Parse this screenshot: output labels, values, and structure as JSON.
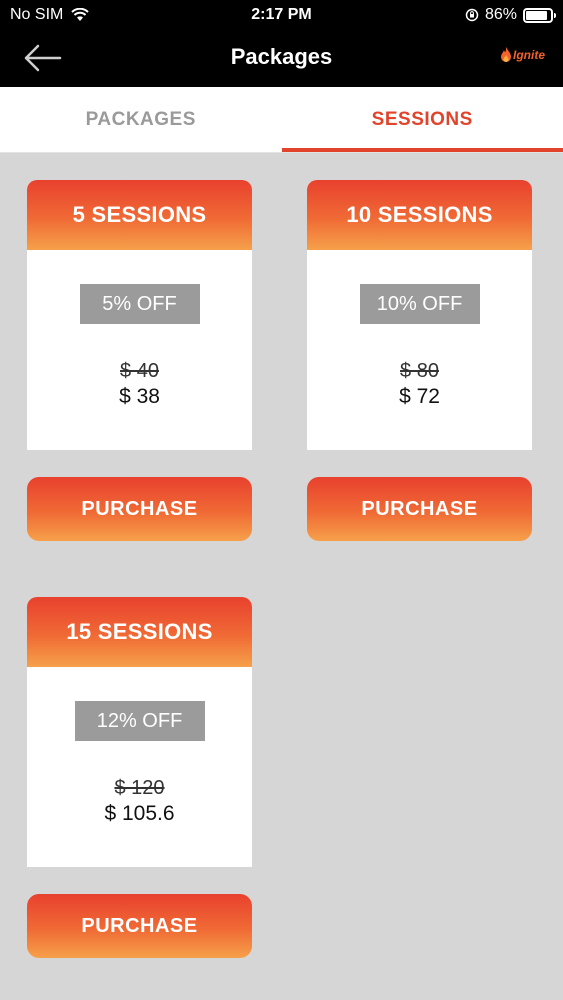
{
  "status_bar": {
    "carrier": "No SIM",
    "time": "2:17 PM",
    "battery_percent": "86%",
    "battery_level": 0.86
  },
  "nav": {
    "title": "Packages",
    "back_icon": "arrow-left-icon",
    "logo_text": "Ignite",
    "logo_icon": "flame-icon"
  },
  "tabs": [
    {
      "label": "PACKAGES",
      "selected": false
    },
    {
      "label": "SESSIONS",
      "selected": true
    }
  ],
  "packages": [
    {
      "title": "5 SESSIONS",
      "discount": "5% OFF",
      "old_price": "$ 40",
      "new_price": "$ 38",
      "button": "PURCHASE"
    },
    {
      "title": "10 SESSIONS",
      "discount": "10% OFF",
      "old_price": "$ 80",
      "new_price": "$ 72",
      "button": "PURCHASE"
    },
    {
      "title": "15 SESSIONS",
      "discount": "12% OFF",
      "old_price": "$ 120",
      "new_price": "$ 105.6",
      "button": "PURCHASE"
    }
  ],
  "colors": {
    "accent": "#e2432b",
    "gradient_top": "#e8412e",
    "gradient_bottom": "#f6a04a",
    "badge": "#9b9b9b",
    "background": "#d6d6d6"
  }
}
